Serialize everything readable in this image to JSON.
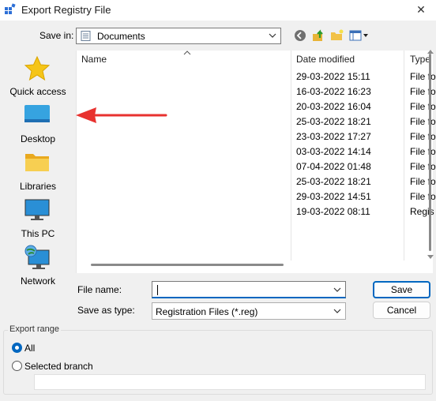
{
  "window": {
    "title": "Export Registry File",
    "close_glyph": "✕"
  },
  "save_in": {
    "label": "Save in:",
    "value": "Documents"
  },
  "places": [
    {
      "label": "Quick access",
      "icon": "star-icon"
    },
    {
      "label": "Desktop",
      "icon": "desktop-icon"
    },
    {
      "label": "Libraries",
      "icon": "folder-icon"
    },
    {
      "label": "This PC",
      "icon": "monitor-icon"
    },
    {
      "label": "Network",
      "icon": "network-icon"
    }
  ],
  "file_list": {
    "columns": [
      "Name",
      "Date modified",
      "Type"
    ],
    "rows": [
      {
        "date": "29-03-2022 15:11",
        "type": "File fo"
      },
      {
        "date": "16-03-2022 16:23",
        "type": "File fo"
      },
      {
        "date": "20-03-2022 16:04",
        "type": "File fo"
      },
      {
        "date": "25-03-2022 18:21",
        "type": "File fo"
      },
      {
        "date": "23-03-2022 17:27",
        "type": "File fo"
      },
      {
        "date": "03-03-2022 14:14",
        "type": "File fo"
      },
      {
        "date": "07-04-2022 01:48",
        "type": "File fo"
      },
      {
        "date": "25-03-2022 18:21",
        "type": "File fo"
      },
      {
        "date": "29-03-2022 14:51",
        "type": "File fo"
      },
      {
        "date": "19-03-2022 08:11",
        "type": "Regis"
      }
    ]
  },
  "file_name": {
    "label": "File name:",
    "value": ""
  },
  "save_as_type": {
    "label": "Save as type:",
    "value": "Registration Files (*.reg)"
  },
  "buttons": {
    "save": "Save",
    "cancel": "Cancel"
  },
  "export_range": {
    "title": "Export range",
    "options": [
      {
        "label": "All",
        "checked": true
      },
      {
        "label": "Selected branch",
        "checked": false
      }
    ],
    "branch_value": ""
  },
  "colors": {
    "accent": "#0067c0",
    "annotation_arrow": "#e8322f"
  }
}
